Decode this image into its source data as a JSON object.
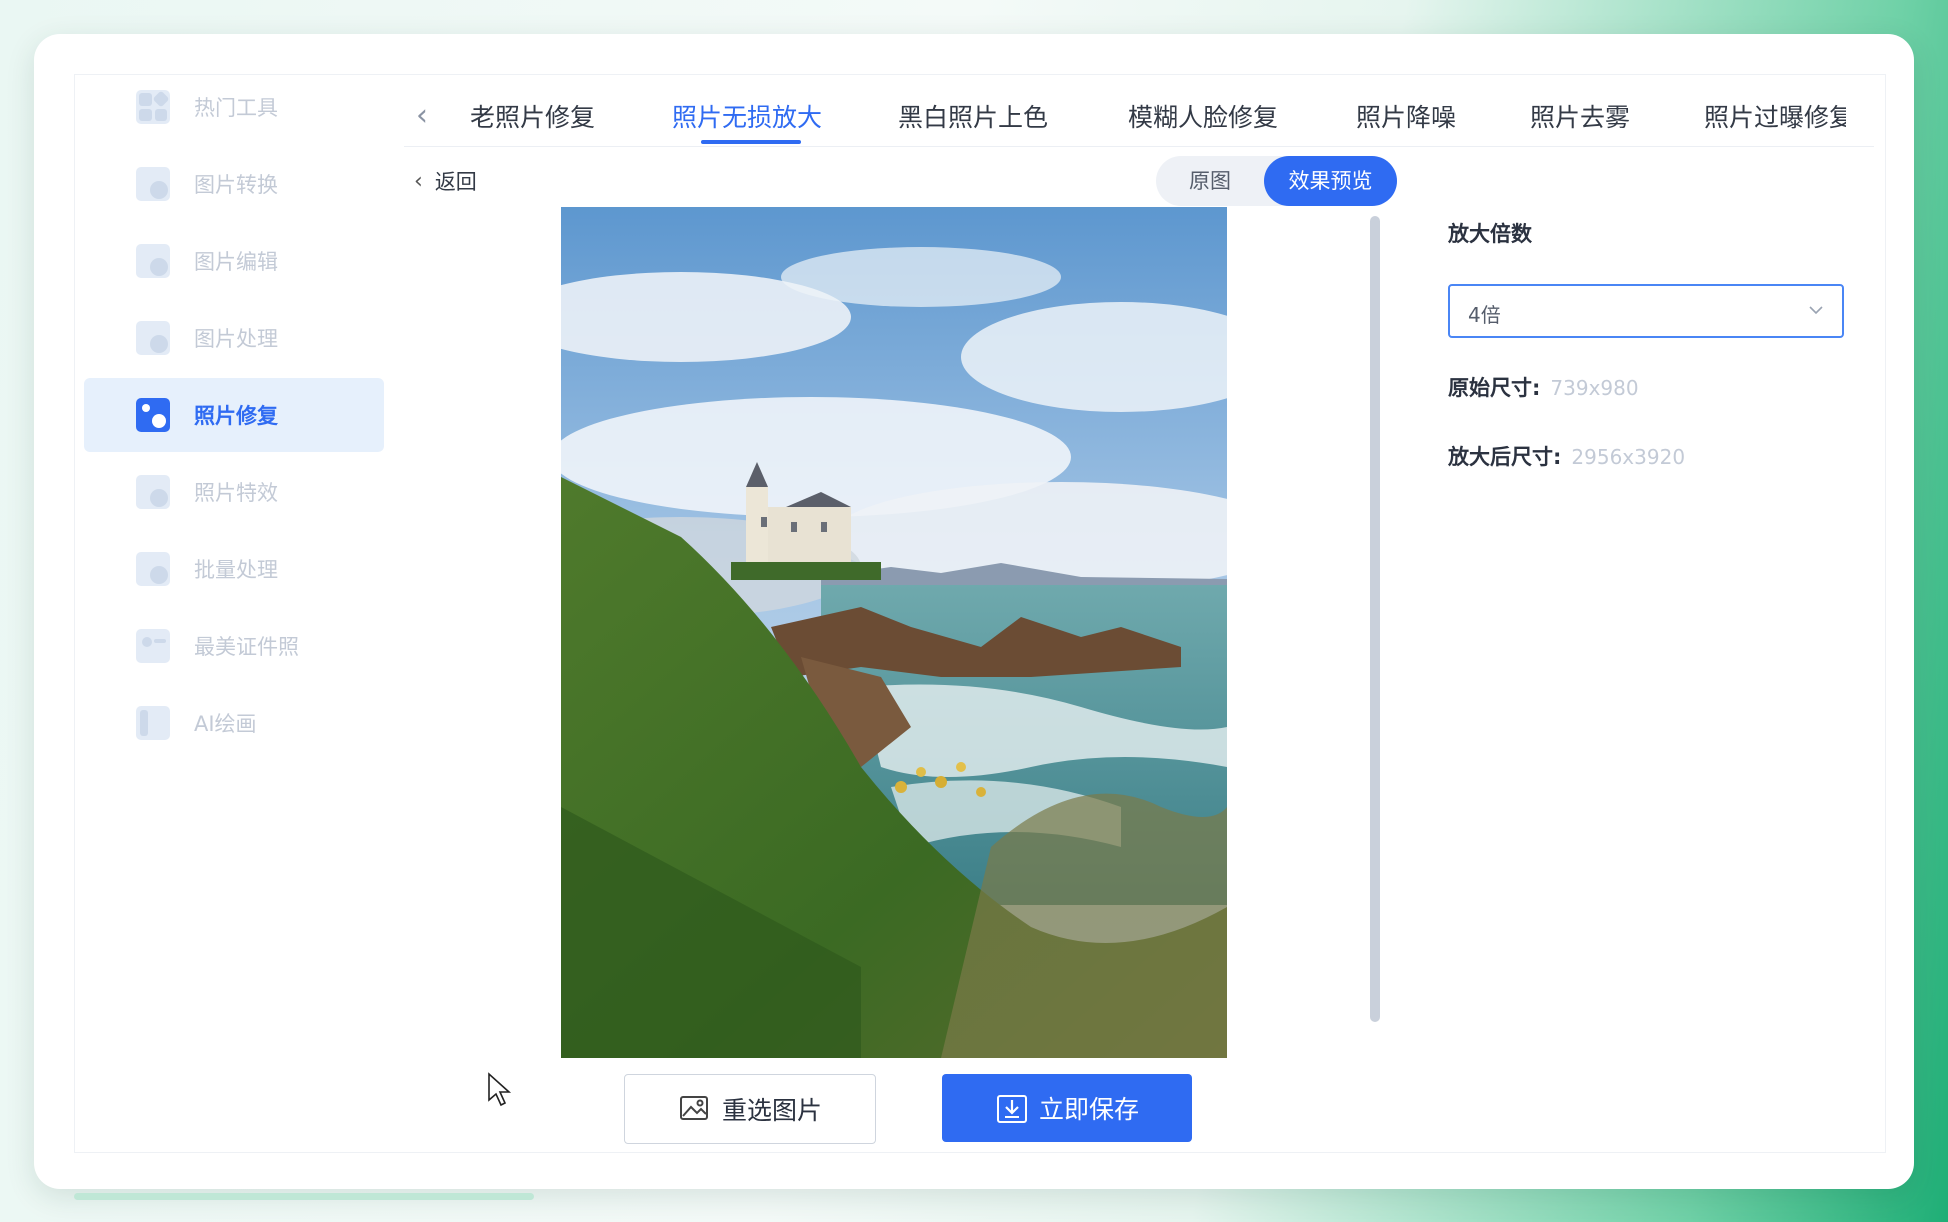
{
  "sidebar": {
    "items": [
      {
        "label": "热门工具",
        "icon": "grid-icon"
      },
      {
        "label": "图片转换",
        "icon": "image-convert-icon"
      },
      {
        "label": "图片编辑",
        "icon": "image-edit-icon"
      },
      {
        "label": "图片处理",
        "icon": "image-process-icon"
      },
      {
        "label": "照片修复",
        "icon": "photo-repair-icon"
      },
      {
        "label": "照片特效",
        "icon": "photo-effect-icon"
      },
      {
        "label": "批量处理",
        "icon": "batch-icon"
      },
      {
        "label": "最美证件照",
        "icon": "id-photo-icon"
      },
      {
        "label": "AI绘画",
        "icon": "ai-paint-icon"
      }
    ],
    "active_index": 4
  },
  "tabs": {
    "items": [
      "老照片修复",
      "照片无损放大",
      "黑白照片上色",
      "模糊人脸修复",
      "照片降噪",
      "照片去雾",
      "照片过曝修复"
    ],
    "active_index": 1
  },
  "back_label": "返回",
  "toggle": {
    "original": "原图",
    "preview": "效果预览",
    "active": "preview"
  },
  "panel": {
    "scale_title": "放大倍数",
    "scale_value": "4倍",
    "original_size_label": "原始尺寸:",
    "original_size_value": "739x980",
    "scaled_size_label": "放大后尺寸:",
    "scaled_size_value": "2956x3920"
  },
  "buttons": {
    "reselect": "重选图片",
    "save": "立即保存"
  },
  "colors": {
    "accent": "#2f6bf2",
    "muted": "#c3cad6"
  }
}
